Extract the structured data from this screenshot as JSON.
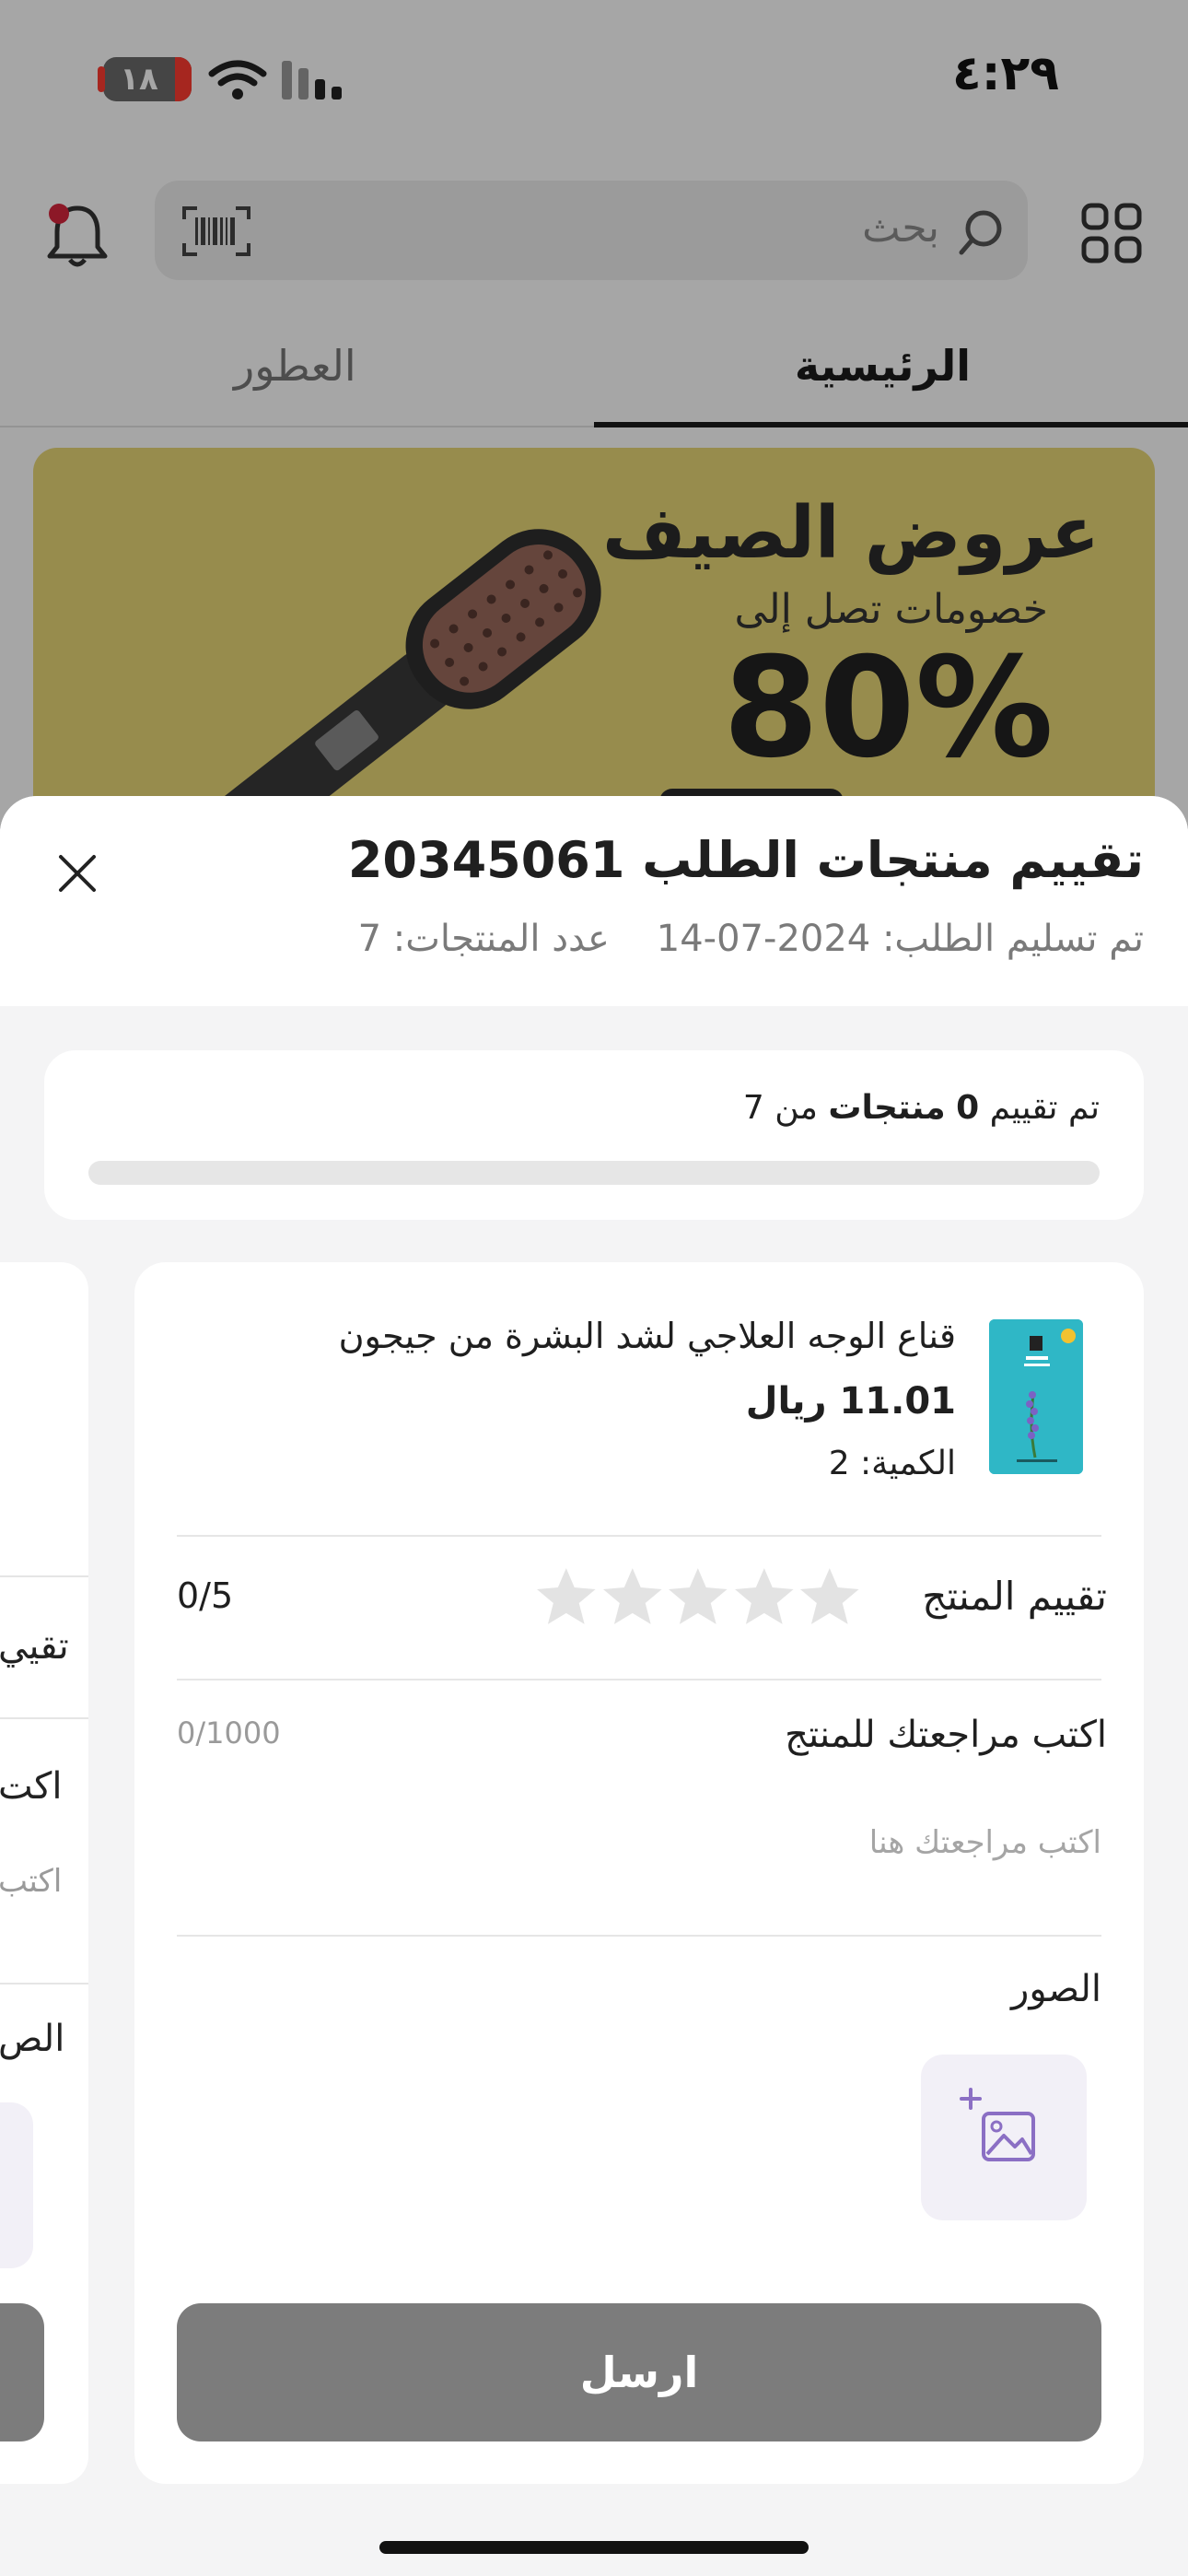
{
  "status_bar": {
    "time": "٤:٢٩",
    "battery_level": "١٨"
  },
  "header": {
    "search_placeholder": "بحث"
  },
  "tabs": [
    {
      "label": "الرئيسية",
      "active": true
    },
    {
      "label": "العطور",
      "active": false
    }
  ],
  "banner": {
    "title": "عروض الصيف",
    "subtitle": "خصومات تصل إلى",
    "discount": "80%"
  },
  "sheet": {
    "title": "تقييم منتجات الطلب 20345061",
    "delivered_text": "تم تسليم الطلب: 2024-07-14",
    "products_count_text": "عدد المنتجات: 7",
    "progress": {
      "prefix": "تم تقييم",
      "rated": "0",
      "unit": "منتجات",
      "middle": "من",
      "total": "7",
      "fraction": 0
    },
    "product": {
      "name": "قناع الوجه العلاجي لشد البشرة من جيجون",
      "price": "11.01 ريال",
      "quantity": "الكمية: 2",
      "rating_label": "تقييم المنتج",
      "rating_value": "0/5",
      "stars_filled": 0,
      "review_label": "اكتب مراجعتك للمنتج",
      "review_count": "0/1000",
      "review_placeholder": "اكتب مراجعتك هنا",
      "photos_label": "الصور",
      "submit_label": "ارسل"
    },
    "next_card_peek": {
      "rating_label": "تقيي",
      "review_label": "اكت",
      "review_placeholder": "اكتب",
      "photos_label": "الص"
    }
  },
  "colors": {
    "accent": "#1f1f1f",
    "submit_disabled": "#7c7c7c",
    "star_empty": "#e3e3e3",
    "banner_bg": "#e8d777",
    "notification_dot": "#d7263d",
    "photo_icon": "#8b6fc4"
  }
}
